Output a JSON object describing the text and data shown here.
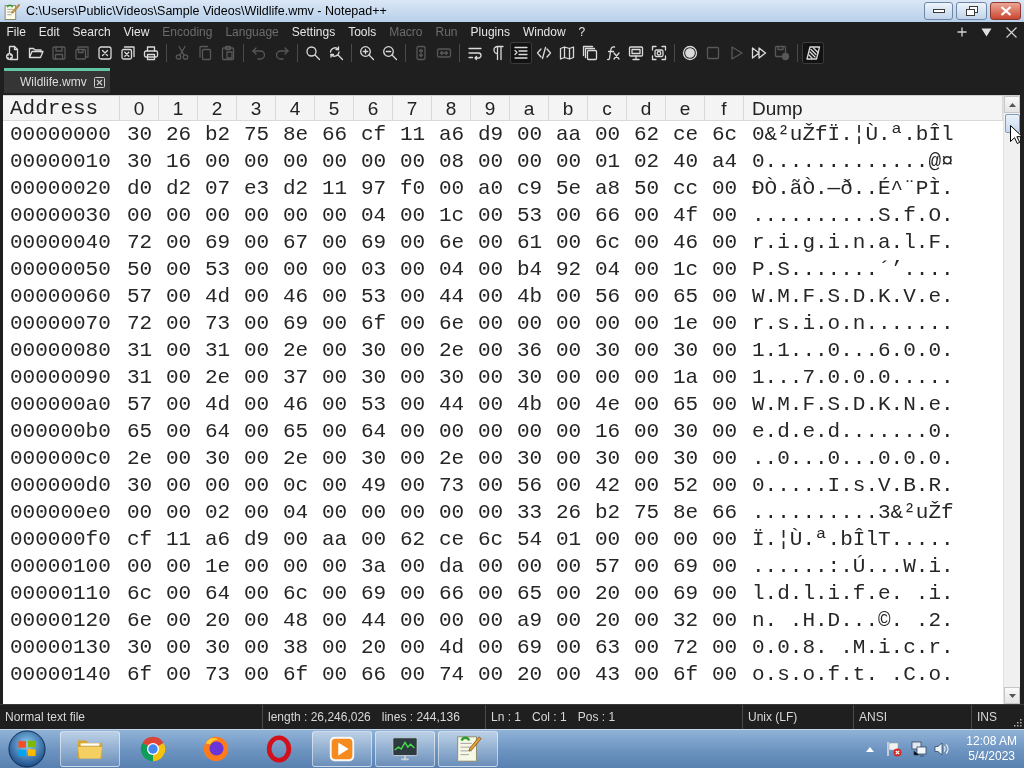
{
  "window": {
    "title": "C:\\Users\\Public\\Videos\\Sample Videos\\Wildlife.wmv - Notepad++"
  },
  "menu": [
    {
      "label": "File",
      "disabled": false
    },
    {
      "label": "Edit",
      "disabled": false
    },
    {
      "label": "Search",
      "disabled": false
    },
    {
      "label": "View",
      "disabled": false
    },
    {
      "label": "Encoding",
      "disabled": true
    },
    {
      "label": "Language",
      "disabled": true
    },
    {
      "label": "Settings",
      "disabled": false
    },
    {
      "label": "Tools",
      "disabled": false
    },
    {
      "label": "Macro",
      "disabled": true
    },
    {
      "label": "Run",
      "disabled": true
    },
    {
      "label": "Plugins",
      "disabled": false
    },
    {
      "label": "Window",
      "disabled": false
    },
    {
      "label": "?",
      "disabled": false
    }
  ],
  "toolbar": [
    [
      {
        "kind": "new",
        "disabled": false,
        "pressed": false
      },
      {
        "kind": "open",
        "disabled": false,
        "pressed": false
      },
      {
        "kind": "save",
        "disabled": true,
        "pressed": false
      },
      {
        "kind": "saveall",
        "disabled": true,
        "pressed": false
      },
      {
        "kind": "close",
        "disabled": false,
        "pressed": false
      },
      {
        "kind": "closeall",
        "disabled": false,
        "pressed": false
      },
      {
        "kind": "print",
        "disabled": false,
        "pressed": false
      }
    ],
    [
      {
        "kind": "cut",
        "disabled": true,
        "pressed": false
      },
      {
        "kind": "copy",
        "disabled": true,
        "pressed": false
      },
      {
        "kind": "paste",
        "disabled": true,
        "pressed": false
      }
    ],
    [
      {
        "kind": "undo",
        "disabled": true,
        "pressed": false
      },
      {
        "kind": "redo",
        "disabled": true,
        "pressed": false
      }
    ],
    [
      {
        "kind": "find",
        "disabled": false,
        "pressed": false
      },
      {
        "kind": "replace",
        "disabled": false,
        "pressed": false
      }
    ],
    [
      {
        "kind": "zoomin",
        "disabled": false,
        "pressed": false
      },
      {
        "kind": "zoomout",
        "disabled": false,
        "pressed": false
      }
    ],
    [
      {
        "kind": "syncv",
        "disabled": true,
        "pressed": false
      },
      {
        "kind": "synch",
        "disabled": true,
        "pressed": false
      }
    ],
    [
      {
        "kind": "wrap",
        "disabled": false,
        "pressed": false
      },
      {
        "kind": "allchars",
        "disabled": false,
        "pressed": false
      },
      {
        "kind": "indent",
        "disabled": false,
        "pressed": true
      },
      {
        "kind": "language",
        "disabled": false,
        "pressed": false
      },
      {
        "kind": "map",
        "disabled": false,
        "pressed": false
      },
      {
        "kind": "pages",
        "disabled": false,
        "pressed": false
      },
      {
        "kind": "function",
        "disabled": false,
        "pressed": false
      },
      {
        "kind": "monitor",
        "disabled": false,
        "pressed": false
      },
      {
        "kind": "focus",
        "disabled": false,
        "pressed": false
      }
    ],
    [
      {
        "kind": "record",
        "disabled": false,
        "pressed": false
      },
      {
        "kind": "stop",
        "disabled": true,
        "pressed": false
      },
      {
        "kind": "play",
        "disabled": true,
        "pressed": false
      },
      {
        "kind": "playmulti",
        "disabled": false,
        "pressed": false
      },
      {
        "kind": "savemacro",
        "disabled": true,
        "pressed": false
      }
    ],
    [
      {
        "kind": "plugin",
        "disabled": false,
        "pressed": true
      }
    ]
  ],
  "tabs": [
    {
      "label": "Wildlife.wmv",
      "selected": true
    }
  ],
  "hex_view": {
    "columns": [
      "Address",
      "0",
      "1",
      "2",
      "3",
      "4",
      "5",
      "6",
      "7",
      "8",
      "9",
      "a",
      "b",
      "c",
      "d",
      "e",
      "f",
      "Dump"
    ],
    "rows": [
      {
        "address": "00000000",
        "bytes": [
          "30",
          "26",
          "b2",
          "75",
          "8e",
          "66",
          "cf",
          "11",
          "a6",
          "d9",
          "00",
          "aa",
          "00",
          "62",
          "ce",
          "6c"
        ],
        "dump": "0&²uŽfÏ.¦Ù.ª.bÎl"
      },
      {
        "address": "00000010",
        "bytes": [
          "30",
          "16",
          "00",
          "00",
          "00",
          "00",
          "00",
          "00",
          "08",
          "00",
          "00",
          "00",
          "01",
          "02",
          "40",
          "a4"
        ],
        "dump": "0.............@¤"
      },
      {
        "address": "00000020",
        "bytes": [
          "d0",
          "d2",
          "07",
          "e3",
          "d2",
          "11",
          "97",
          "f0",
          "00",
          "a0",
          "c9",
          "5e",
          "a8",
          "50",
          "cc",
          "00"
        ],
        "dump": "ÐÒ.ãÒ.—ð..É^¨PÌ."
      },
      {
        "address": "00000030",
        "bytes": [
          "00",
          "00",
          "00",
          "00",
          "00",
          "00",
          "04",
          "00",
          "1c",
          "00",
          "53",
          "00",
          "66",
          "00",
          "4f",
          "00"
        ],
        "dump": "..........S.f.O."
      },
      {
        "address": "00000040",
        "bytes": [
          "72",
          "00",
          "69",
          "00",
          "67",
          "00",
          "69",
          "00",
          "6e",
          "00",
          "61",
          "00",
          "6c",
          "00",
          "46",
          "00"
        ],
        "dump": "r.i.g.i.n.a.l.F."
      },
      {
        "address": "00000050",
        "bytes": [
          "50",
          "00",
          "53",
          "00",
          "00",
          "00",
          "03",
          "00",
          "04",
          "00",
          "b4",
          "92",
          "04",
          "00",
          "1c",
          "00"
        ],
        "dump": "P.S.......´’...."
      },
      {
        "address": "00000060",
        "bytes": [
          "57",
          "00",
          "4d",
          "00",
          "46",
          "00",
          "53",
          "00",
          "44",
          "00",
          "4b",
          "00",
          "56",
          "00",
          "65",
          "00"
        ],
        "dump": "W.M.F.S.D.K.V.e."
      },
      {
        "address": "00000070",
        "bytes": [
          "72",
          "00",
          "73",
          "00",
          "69",
          "00",
          "6f",
          "00",
          "6e",
          "00",
          "00",
          "00",
          "00",
          "00",
          "1e",
          "00"
        ],
        "dump": "r.s.i.o.n......."
      },
      {
        "address": "00000080",
        "bytes": [
          "31",
          "00",
          "31",
          "00",
          "2e",
          "00",
          "30",
          "00",
          "2e",
          "00",
          "36",
          "00",
          "30",
          "00",
          "30",
          "00"
        ],
        "dump": "1.1...0...6.0.0."
      },
      {
        "address": "00000090",
        "bytes": [
          "31",
          "00",
          "2e",
          "00",
          "37",
          "00",
          "30",
          "00",
          "30",
          "00",
          "30",
          "00",
          "00",
          "00",
          "1a",
          "00"
        ],
        "dump": "1...7.0.0.0....."
      },
      {
        "address": "000000a0",
        "bytes": [
          "57",
          "00",
          "4d",
          "00",
          "46",
          "00",
          "53",
          "00",
          "44",
          "00",
          "4b",
          "00",
          "4e",
          "00",
          "65",
          "00"
        ],
        "dump": "W.M.F.S.D.K.N.e."
      },
      {
        "address": "000000b0",
        "bytes": [
          "65",
          "00",
          "64",
          "00",
          "65",
          "00",
          "64",
          "00",
          "00",
          "00",
          "00",
          "00",
          "16",
          "00",
          "30",
          "00"
        ],
        "dump": "e.d.e.d.......0."
      },
      {
        "address": "000000c0",
        "bytes": [
          "2e",
          "00",
          "30",
          "00",
          "2e",
          "00",
          "30",
          "00",
          "2e",
          "00",
          "30",
          "00",
          "30",
          "00",
          "30",
          "00"
        ],
        "dump": "..0...0...0.0.0."
      },
      {
        "address": "000000d0",
        "bytes": [
          "30",
          "00",
          "00",
          "00",
          "0c",
          "00",
          "49",
          "00",
          "73",
          "00",
          "56",
          "00",
          "42",
          "00",
          "52",
          "00"
        ],
        "dump": "0.....I.s.V.B.R."
      },
      {
        "address": "000000e0",
        "bytes": [
          "00",
          "00",
          "02",
          "00",
          "04",
          "00",
          "00",
          "00",
          "00",
          "00",
          "33",
          "26",
          "b2",
          "75",
          "8e",
          "66"
        ],
        "dump": "..........3&²uŽf"
      },
      {
        "address": "000000f0",
        "bytes": [
          "cf",
          "11",
          "a6",
          "d9",
          "00",
          "aa",
          "00",
          "62",
          "ce",
          "6c",
          "54",
          "01",
          "00",
          "00",
          "00",
          "00"
        ],
        "dump": "Ï.¦Ù.ª.bÎlT....."
      },
      {
        "address": "00000100",
        "bytes": [
          "00",
          "00",
          "1e",
          "00",
          "00",
          "00",
          "3a",
          "00",
          "da",
          "00",
          "00",
          "00",
          "57",
          "00",
          "69",
          "00"
        ],
        "dump": "......:.Ú...W.i."
      },
      {
        "address": "00000110",
        "bytes": [
          "6c",
          "00",
          "64",
          "00",
          "6c",
          "00",
          "69",
          "00",
          "66",
          "00",
          "65",
          "00",
          "20",
          "00",
          "69",
          "00"
        ],
        "dump": "l.d.l.i.f.e. .i."
      },
      {
        "address": "00000120",
        "bytes": [
          "6e",
          "00",
          "20",
          "00",
          "48",
          "00",
          "44",
          "00",
          "00",
          "00",
          "a9",
          "00",
          "20",
          "00",
          "32",
          "00"
        ],
        "dump": "n. .H.D...©. .2."
      },
      {
        "address": "00000130",
        "bytes": [
          "30",
          "00",
          "30",
          "00",
          "38",
          "00",
          "20",
          "00",
          "4d",
          "00",
          "69",
          "00",
          "63",
          "00",
          "72",
          "00"
        ],
        "dump": "0.0.8. .M.i.c.r."
      },
      {
        "address": "00000140",
        "bytes": [
          "6f",
          "00",
          "73",
          "00",
          "6f",
          "00",
          "66",
          "00",
          "74",
          "00",
          "20",
          "00",
          "43",
          "00",
          "6f",
          "00"
        ],
        "dump": "o.s.o.f.t. .C.o."
      }
    ]
  },
  "status_bar": [
    [
      "Normal text file"
    ],
    [
      "length : 26,246,026",
      "lines : 244,136"
    ],
    [
      "Ln : 1",
      "Col : 1",
      "Pos : 1"
    ],
    [
      "Unix (LF)"
    ],
    [
      "ANSI"
    ],
    [
      "INS"
    ]
  ],
  "taskbar": {
    "apps": [
      {
        "kind": "folder",
        "running": true
      },
      {
        "kind": "tricolor",
        "running": false
      },
      {
        "kind": "swirl",
        "running": false
      },
      {
        "kind": "ring",
        "running": false
      },
      {
        "kind": "media",
        "running": true
      },
      {
        "kind": "monitor",
        "running": true
      },
      {
        "kind": "notepad",
        "running": true
      }
    ],
    "clock": {
      "time": "12:08 AM",
      "date": "5/4/2023"
    }
  }
}
